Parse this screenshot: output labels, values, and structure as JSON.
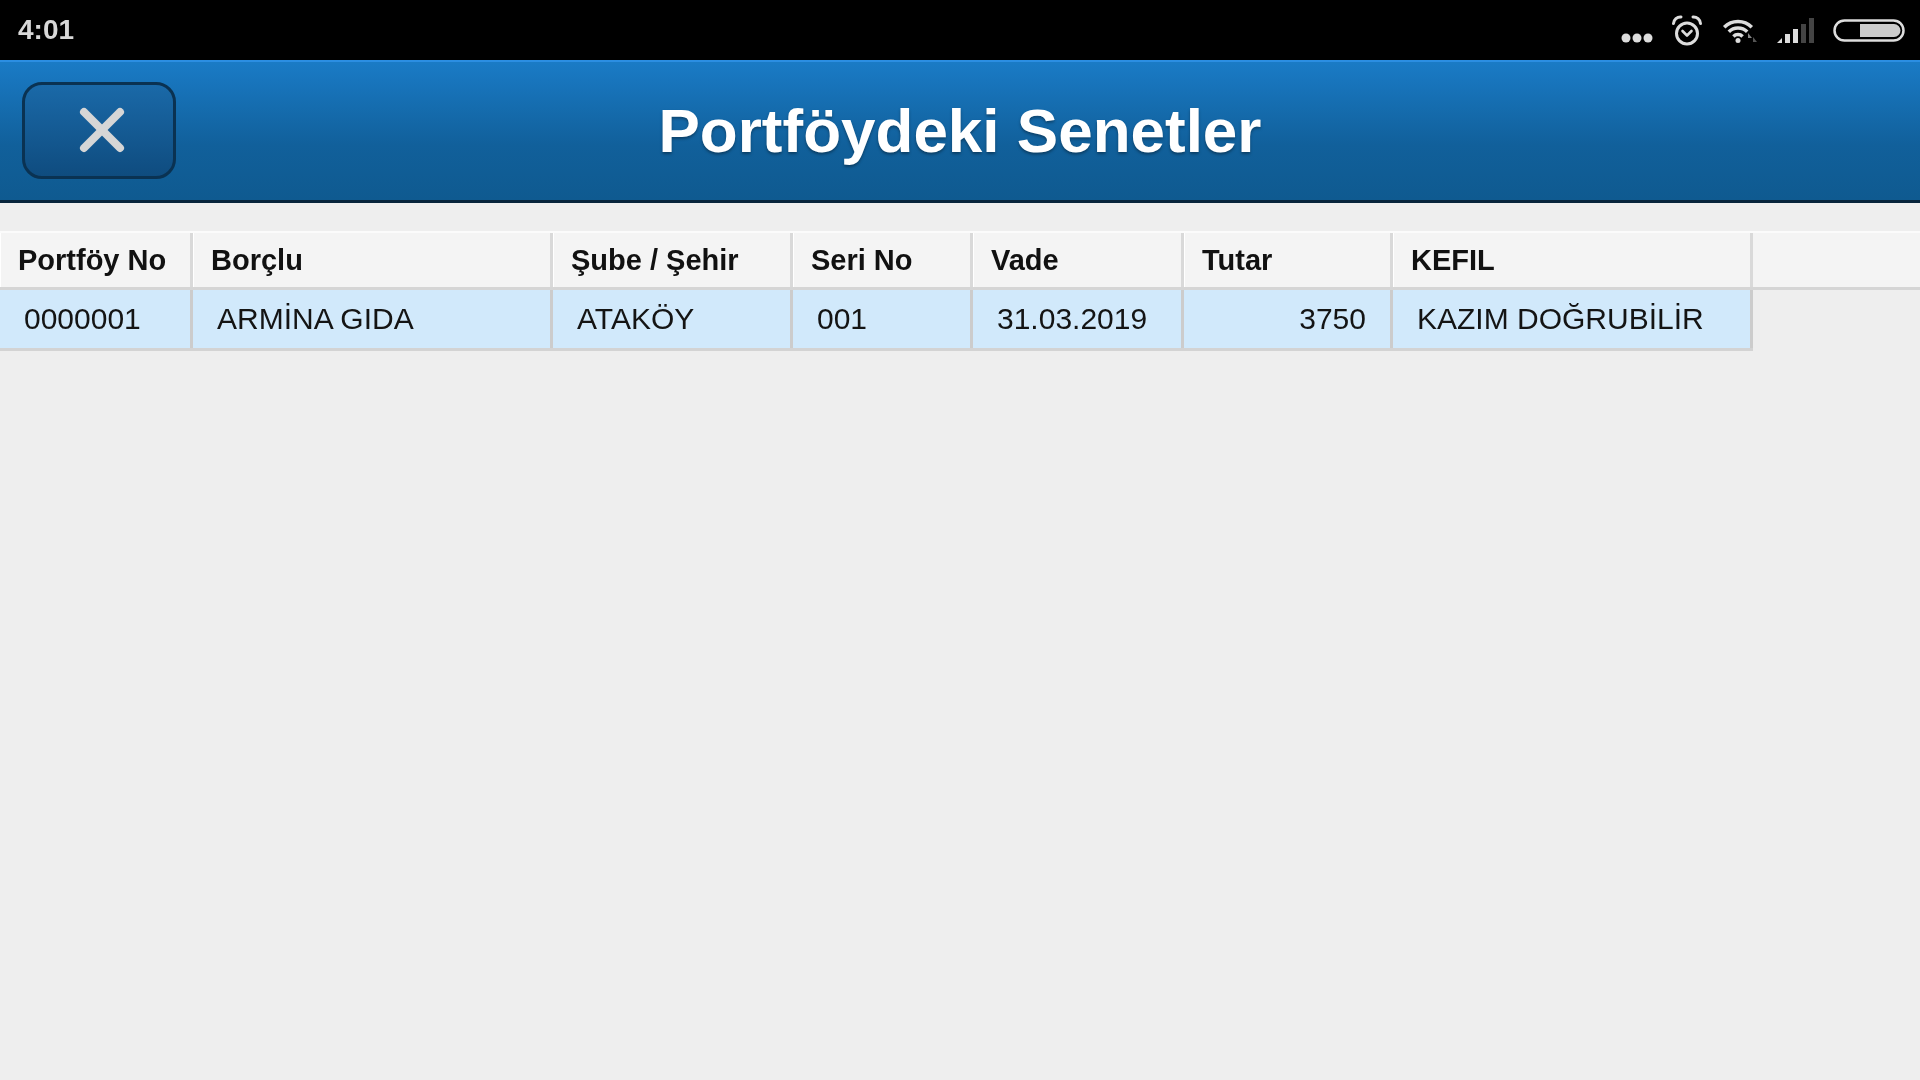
{
  "status_bar": {
    "time": "4:01"
  },
  "header": {
    "title": "Portföydeki Senetler"
  },
  "table": {
    "columns": [
      {
        "label": "Portföy No",
        "kind": "text"
      },
      {
        "label": "Borçlu",
        "kind": "text"
      },
      {
        "label": "Şube / Şehir",
        "kind": "text"
      },
      {
        "label": "Seri No",
        "kind": "text"
      },
      {
        "label": "Vade",
        "kind": "text"
      },
      {
        "label": "Tutar",
        "kind": "number"
      },
      {
        "label": "KEFIL",
        "kind": "text"
      }
    ],
    "rows": [
      {
        "cells": [
          "0000001",
          "ARMİNA GIDA",
          "ATAKÖY",
          "001",
          "31.03.2019",
          "3750",
          "KAZIM DOĞRUBİLİR"
        ]
      }
    ]
  }
}
